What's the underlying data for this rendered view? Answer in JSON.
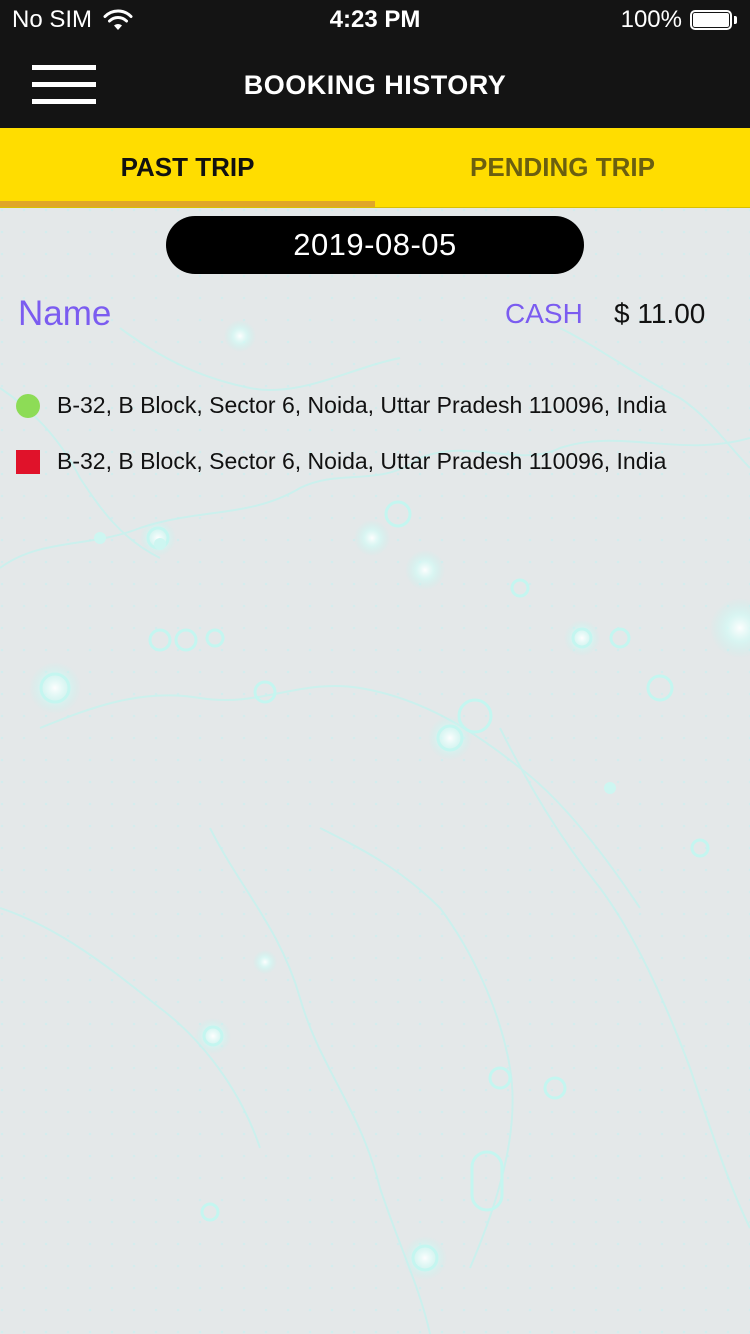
{
  "status_bar": {
    "carrier": "No SIM",
    "time": "4:23 PM",
    "battery": "100%"
  },
  "nav": {
    "title": "BOOKING HISTORY",
    "menu_icon": "hamburger-menu-icon"
  },
  "tabs": [
    {
      "label": "PAST TRIP",
      "active": true
    },
    {
      "label": "PENDING TRIP",
      "active": false
    }
  ],
  "trip": {
    "date": "2019-08-05",
    "name": "Name",
    "payment_method": "CASH",
    "fare": "$ 11.00",
    "pickup_address": "B-32, B Block, Sector 6, Noida, Uttar Pradesh 110096, India",
    "drop_address": "B-32, B Block, Sector 6, Noida, Uttar Pradesh 110096, India"
  },
  "colors": {
    "nav_background": "#141414",
    "tab_background": "#ffdd00",
    "tab_indicator": "#e0a628",
    "accent_purple": "#7b5cf0",
    "pickup_green": "#8ddc56",
    "drop_red": "#e0122a"
  }
}
